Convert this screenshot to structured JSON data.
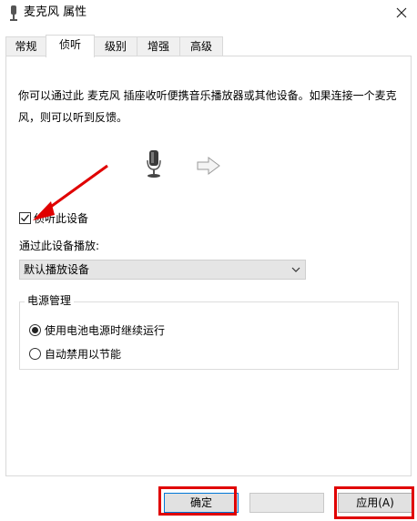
{
  "window": {
    "title": "麦克风 属性",
    "icon": "microphone-icon"
  },
  "tabs": [
    {
      "label": "常规",
      "active": false
    },
    {
      "label": "侦听",
      "active": true
    },
    {
      "label": "级别",
      "active": false
    },
    {
      "label": "增强",
      "active": false
    },
    {
      "label": "高级",
      "active": false
    }
  ],
  "listen": {
    "description": "你可以通过此 麦克风 插座收听便携音乐播放器或其他设备。如果连接一个麦克风，则可以听到反馈。",
    "listen_checkbox": {
      "label": "侦听此设备",
      "checked": true
    },
    "playback_label": "通过此设备播放:",
    "playback_select": {
      "value": "默认播放设备"
    }
  },
  "power": {
    "title": "电源管理",
    "options": [
      {
        "label": "使用电池电源时继续运行",
        "selected": true
      },
      {
        "label": "自动禁用以节能",
        "selected": false
      }
    ]
  },
  "buttons": {
    "ok": "确定",
    "cancel": "",
    "apply": "应用(A)"
  },
  "colors": {
    "annotation": "#e00000",
    "focus_border": "#0078d7"
  }
}
